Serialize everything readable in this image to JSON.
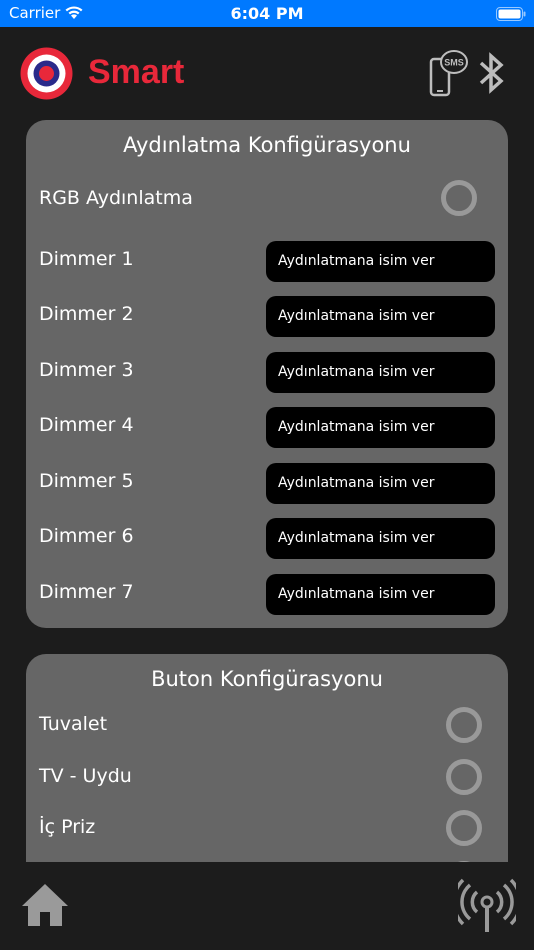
{
  "status_bar": {
    "carrier": "Carrier",
    "time": "6:04 PM"
  },
  "header": {
    "brand": "Smart",
    "sms_label": "SMS"
  },
  "lighting": {
    "title": "Aydınlatma Konfigürasyonu",
    "rgb_label": "RGB Aydınlatma",
    "dimmers": [
      {
        "label": "Dimmer 1",
        "placeholder": "Aydınlatmana isim ver"
      },
      {
        "label": "Dimmer 2",
        "placeholder": "Aydınlatmana isim ver"
      },
      {
        "label": "Dimmer 3",
        "placeholder": "Aydınlatmana isim ver"
      },
      {
        "label": "Dimmer 4",
        "placeholder": "Aydınlatmana isim ver"
      },
      {
        "label": "Dimmer 5",
        "placeholder": "Aydınlatmana isim ver"
      },
      {
        "label": "Dimmer 6",
        "placeholder": "Aydınlatmana isim ver"
      },
      {
        "label": "Dimmer 7",
        "placeholder": "Aydınlatmana isim ver"
      }
    ]
  },
  "buttons": {
    "title": "Buton Konfigürasyonu",
    "items": [
      {
        "label": "Tuvalet"
      },
      {
        "label": "TV - Uydu"
      },
      {
        "label": "İç Priz"
      }
    ]
  },
  "colors": {
    "status_bar": "#0079ff",
    "brand": "#e8283a",
    "card": "#666666",
    "background": "#1c1c1c"
  },
  "icons": {
    "home": "home-icon",
    "antenna": "antenna-icon",
    "bluetooth": "bluetooth-icon",
    "sms": "sms-icon"
  }
}
